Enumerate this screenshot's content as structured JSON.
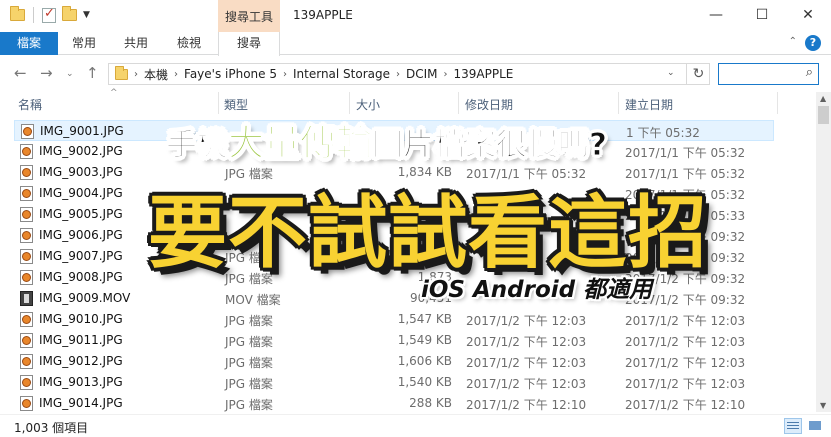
{
  "window": {
    "title": "139APPLE",
    "contextual_tab": "搜尋工具",
    "minimize": "—",
    "maximize": "☐",
    "close": "✕"
  },
  "ribbon": {
    "tabs": [
      "檔案",
      "常用",
      "共用",
      "檢視",
      "搜尋"
    ],
    "collapse_icon": "chevron-up-icon",
    "help": "?"
  },
  "address": {
    "breadcrumbs": [
      "本機",
      "Faye's iPhone 5",
      "Internal Storage",
      "DCIM",
      "139APPLE"
    ],
    "search_value": "",
    "search_placeholder": ""
  },
  "columns": [
    "名稱",
    "類型",
    "大小",
    "修改日期",
    "建立日期"
  ],
  "files": [
    {
      "name": "IMG_9001.JPG",
      "type": "",
      "size": "",
      "modified": "",
      "created": "1 下午 05:32",
      "kind": "jpg",
      "selected": true
    },
    {
      "name": "IMG_9002.JPG",
      "type": "",
      "size": "",
      "modified": "",
      "created": "2017/1/1 下午 05:32",
      "kind": "jpg"
    },
    {
      "name": "IMG_9003.JPG",
      "type": "JPG 檔案",
      "size": "1,834 KB",
      "modified": "2017/1/1 下午 05:32",
      "created": "2017/1/1 下午 05:32",
      "kind": "jpg"
    },
    {
      "name": "IMG_9004.JPG",
      "type": "",
      "size": "",
      "modified": "",
      "created": "2017/1/1 下午 05:32",
      "kind": "jpg"
    },
    {
      "name": "IMG_9005.JPG",
      "type": "",
      "size": "",
      "modified": "",
      "created": "2017/1/1 下午 05:33",
      "kind": "jpg"
    },
    {
      "name": "IMG_9006.JPG",
      "type": "",
      "size": "",
      "modified": "",
      "created": "2017/1/2 下午 09:32",
      "kind": "jpg"
    },
    {
      "name": "IMG_9007.JPG",
      "type": "JPG 檔案",
      "size": "2,151 KB",
      "modified": "",
      "created": "2017/1/2 下午 09:32",
      "kind": "jpg"
    },
    {
      "name": "IMG_9008.JPG",
      "type": "JPG 檔案",
      "size": "1,873",
      "modified": "",
      "created": "2017/1/2 下午 09:32",
      "kind": "jpg"
    },
    {
      "name": "IMG_9009.MOV",
      "type": "MOV 檔案",
      "size": "90,451",
      "modified": "",
      "created": "2017/1/2 下午 09:32",
      "kind": "mov"
    },
    {
      "name": "IMG_9010.JPG",
      "type": "JPG 檔案",
      "size": "1,547 KB",
      "modified": "2017/1/2 下午 12:03",
      "created": "2017/1/2 下午 12:03",
      "kind": "jpg"
    },
    {
      "name": "IMG_9011.JPG",
      "type": "JPG 檔案",
      "size": "1,549 KB",
      "modified": "2017/1/2 下午 12:03",
      "created": "2017/1/2 下午 12:03",
      "kind": "jpg"
    },
    {
      "name": "IMG_9012.JPG",
      "type": "JPG 檔案",
      "size": "1,606 KB",
      "modified": "2017/1/2 下午 12:03",
      "created": "2017/1/2 下午 12:03",
      "kind": "jpg"
    },
    {
      "name": "IMG_9013.JPG",
      "type": "JPG 檔案",
      "size": "1,540 KB",
      "modified": "2017/1/2 下午 12:03",
      "created": "2017/1/2 下午 12:03",
      "kind": "jpg"
    },
    {
      "name": "IMG_9014.JPG",
      "type": "JPG 檔案",
      "size": "288 KB",
      "modified": "2017/1/2 下午 12:10",
      "created": "2017/1/2 下午 12:10",
      "kind": "jpg"
    }
  ],
  "status": {
    "item_count": "1,003 個項目"
  },
  "overlay": {
    "line1_pre": "手機",
    "line1_highlight": "大量傳輸",
    "line1_post": "圖片檔案很慢嗎?",
    "line2": "要不試試看這招",
    "line3": "iOS Android 都適用",
    "highlight_color": "#98c43a",
    "headline_color": "#f8d232"
  },
  "colors": {
    "accent": "#1979ca",
    "contextual_tab_bg": "#f9dcc4",
    "selection_bg": "#e5f3ff"
  }
}
